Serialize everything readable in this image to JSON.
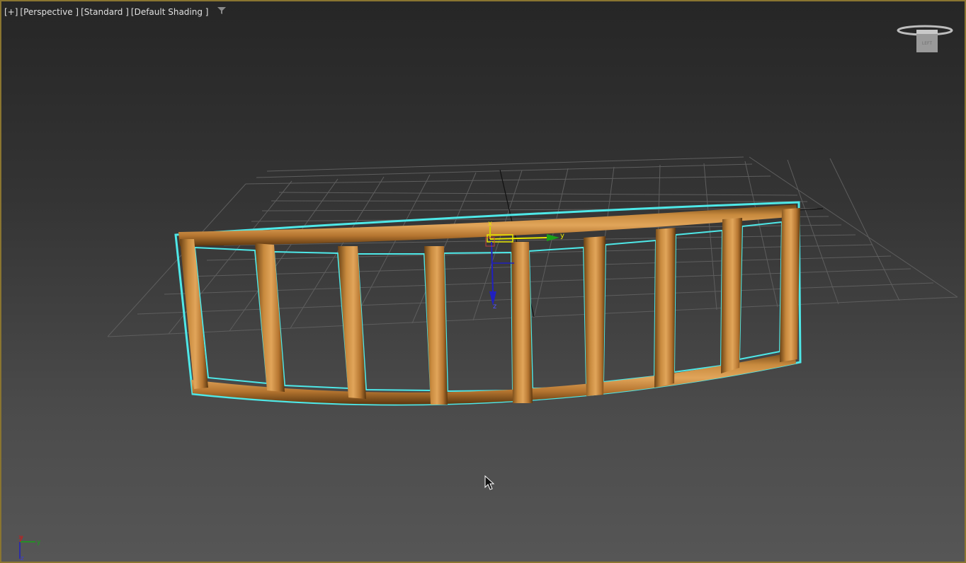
{
  "viewport": {
    "labels": {
      "plus": "[+]",
      "view": "[Perspective ]",
      "mode": "[Standard ]",
      "shading": "[Default Shading ]"
    },
    "filter_icon": "funnel-icon",
    "border_color": "#8a7530"
  },
  "gizmo": {
    "x_label": "x",
    "y_label": "y",
    "z_label": "z",
    "colors": {
      "x": "#d0d000",
      "y": "#18a018",
      "z": "#2020c0"
    }
  },
  "viewcube": {
    "face_label": "LEFT",
    "icon": "viewcube-icon"
  },
  "axis_tripod": {
    "x_label": "x",
    "y_label": "y",
    "z_label": "z"
  },
  "object": {
    "fill_color": "#b8792e",
    "selection_color": "#4ee8e8"
  }
}
